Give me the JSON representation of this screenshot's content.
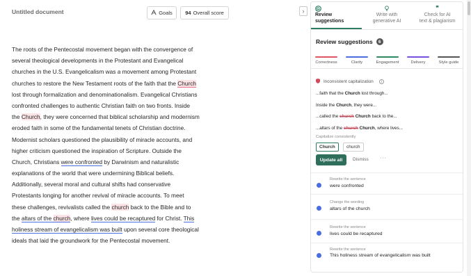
{
  "editor": {
    "doc_title": "Untitled document",
    "goals_label": "Goals",
    "score_value": "94",
    "score_label": "Overall score",
    "lines": [
      [
        {
          "t": "The roots of the Pentecostal movement began with the convergence of"
        }
      ],
      [
        {
          "t": "several theological developments in the Protestant and Evangelical"
        }
      ],
      [
        {
          "t": "churches in the U.S. Evangelicalism was a movement among Protestant"
        }
      ],
      [
        {
          "t": "churches to restore the New Testament roots of the faith that the "
        },
        {
          "t": "Church",
          "c": "hl-pink"
        }
      ],
      [
        {
          "t": "lost through formalization and denominationalism. Evangelical Christians"
        }
      ],
      [
        {
          "t": "confronted challenges to authentic Christian faith on two fronts. Inside"
        }
      ],
      [
        {
          "t": "the "
        },
        {
          "t": "Church",
          "c": "hl-pink-soft"
        },
        {
          "t": ", they were concerned that biblical scholarship and modernism"
        }
      ],
      [
        {
          "t": "eroded faith in some of the fundamental tenets of Christian doctrine."
        }
      ],
      [
        {
          "t": "Modernist scholars questioned the plausibility of miracle accounts, and"
        }
      ],
      [
        {
          "t": "higher criticism questioned the inspiration of Scripture. Outside the"
        }
      ],
      [
        {
          "t": "Church, Christians "
        },
        {
          "t": "were confronted",
          "c": "ul-blue"
        },
        {
          "t": " by Darwinism and naturalistic"
        }
      ],
      [
        {
          "t": "explanations of the world that were undermining Biblical beliefs."
        }
      ],
      [
        {
          "t": "Additionally, several moral and cultural shifts had conservative"
        }
      ],
      [
        {
          "t": "Protestants longing for another revival of miracle accounts. To meet"
        }
      ],
      [
        {
          "t": "these challenges, revivalists called the "
        },
        {
          "t": "church",
          "c": "hl-pink-soft"
        },
        {
          "t": " back to the Bible and to"
        }
      ],
      [
        {
          "t": "the "
        },
        {
          "t": "altars of the ",
          "c": "ul-blue"
        },
        {
          "t": "church",
          "c": "hl-pink-soft ul-blue"
        },
        {
          "t": ", where "
        },
        {
          "t": "lives could be recaptured",
          "c": "ul-blue"
        },
        {
          "t": " for Christ. "
        },
        {
          "t": "This",
          "c": "ul-blue"
        }
      ],
      [
        {
          "t": "holiness stream of evangelicalism was built",
          "c": "ul-blue"
        },
        {
          "t": " upon several core theological"
        }
      ],
      [
        {
          "t": "ideals that laid the groundwork for the Pentecostal movement."
        }
      ]
    ]
  },
  "panel": {
    "tabs": [
      {
        "label1": "Review",
        "label2": "suggestions",
        "icon": "grammar-logo-icon"
      },
      {
        "label1": "Write with",
        "label2": "generative AI",
        "icon": "lightbulb-icon"
      },
      {
        "label1": "Check for AI",
        "label2": "text & plagiarism",
        "icon": "quote-icon"
      }
    ],
    "title": "Review suggestions",
    "count": "6",
    "categories": [
      {
        "label": "Correctness",
        "color": "#e05563"
      },
      {
        "label": "Clarity",
        "color": "#4a6ee0"
      },
      {
        "label": "Engagement",
        "color": "#2e8a5e"
      },
      {
        "label": "Delivery",
        "color": "#7a4ee0"
      },
      {
        "label": "Style guide",
        "color": "#555555"
      }
    ],
    "issue": {
      "title": "Inconsistent capitalization",
      "snippets": [
        {
          "pre": "...faith that the ",
          "bold": "Church",
          "post": " lost through..."
        },
        {
          "pre": "Inside the ",
          "bold": "Church",
          "post": ", they were..."
        },
        {
          "pre": "...called the ",
          "strike": "church",
          "bold": " Church",
          "post": " back to the..."
        },
        {
          "pre": "...altars of the ",
          "strike": "church",
          "bold": " Church",
          "post": ", where lives..."
        }
      ],
      "hint": "Capitalize consistently",
      "option_a": "Church",
      "option_b": "church",
      "update_label": "Update all",
      "dismiss_label": "Dismiss",
      "more_label": "···"
    },
    "cards": [
      {
        "label": "Rewrite the sentence",
        "text": "were confronted"
      },
      {
        "label": "Change the wording",
        "text": "altars of the church"
      },
      {
        "label": "Rewrite the sentence",
        "text": "lives could be recaptured"
      },
      {
        "label": "Rewrite the sentence",
        "text": "This holiness stream of evangelicalism was built"
      }
    ]
  }
}
